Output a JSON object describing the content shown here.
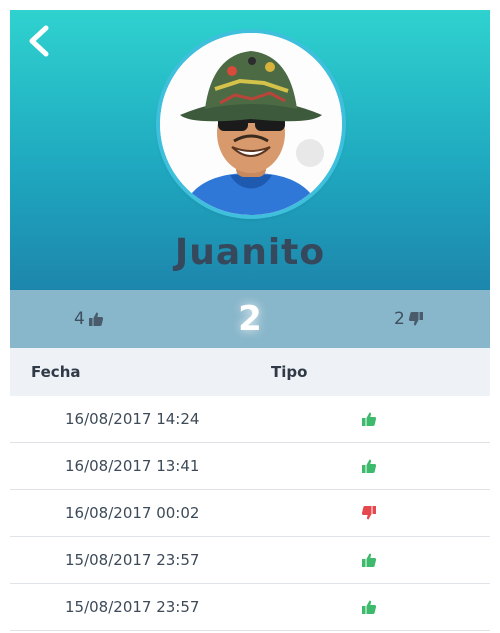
{
  "header": {
    "back_icon": "chevron-left-icon",
    "avatar_alt": "avatar",
    "username": "Juanito"
  },
  "scorebar": {
    "likes": "4",
    "score": "2",
    "dislikes": "2",
    "like_icon": "thumbs-up-icon",
    "dislike_icon": "thumbs-down-icon"
  },
  "table": {
    "columns": [
      "Fecha",
      "Tipo"
    ],
    "rows": [
      {
        "fecha": "16/08/2017 14:24",
        "tipo": "like"
      },
      {
        "fecha": "16/08/2017 13:41",
        "tipo": "like"
      },
      {
        "fecha": "16/08/2017 00:02",
        "tipo": "dislike"
      },
      {
        "fecha": "15/08/2017 23:57",
        "tipo": "like"
      },
      {
        "fecha": "15/08/2017 23:57",
        "tipo": "like"
      }
    ]
  },
  "colors": {
    "like": "#3dba6b",
    "dislike": "#e5484d",
    "header_top": "#2fd2cf",
    "header_bottom": "#1d86ac",
    "scorebar": "#88b6ca"
  }
}
